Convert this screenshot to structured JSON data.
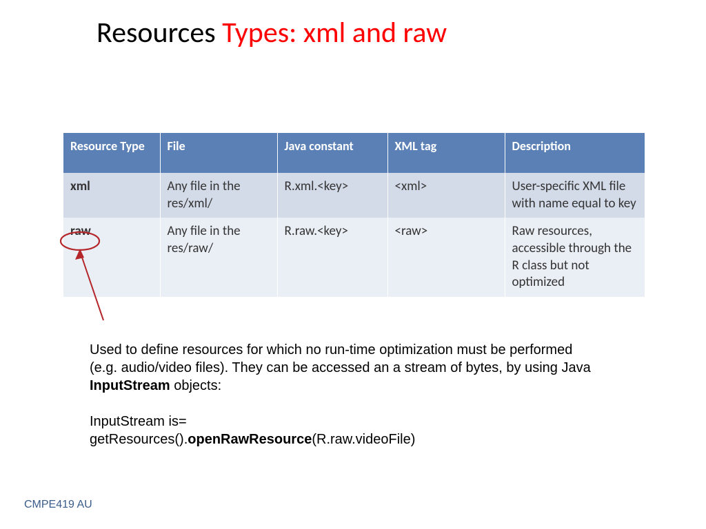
{
  "title": {
    "part1": "Resources ",
    "part2": "Types: xml and raw"
  },
  "table": {
    "headers": [
      "Resource Type",
      "File",
      "Java constant",
      "XML tag",
      "Description"
    ],
    "rows": [
      {
        "rt": "xml",
        "file": "Any file in the res/xml/",
        "jc": "R.xml.<key>",
        "tag": "<xml>",
        "desc": "User-specific XML file with name equal to key"
      },
      {
        "rt": "raw",
        "file": "Any file in the res/raw/",
        "jc": "R.raw.<key>",
        "tag": "<raw>",
        "desc": "Raw resources, accessible through the R class but not optimized"
      }
    ]
  },
  "body": {
    "p1a": "Used to define resources for which no run-time optimization must be performed (e.g. audio/video files).  They can be accessed an a stream of bytes, by using Java ",
    "p1b": "InputStream",
    "p1c": " objects:",
    "p2a": "InputStream is=",
    "p2b": "getResources().",
    "p2c": "openRawResource",
    "p2d": "(R.raw.videoFile)"
  },
  "footer": "CMPE419 AU"
}
